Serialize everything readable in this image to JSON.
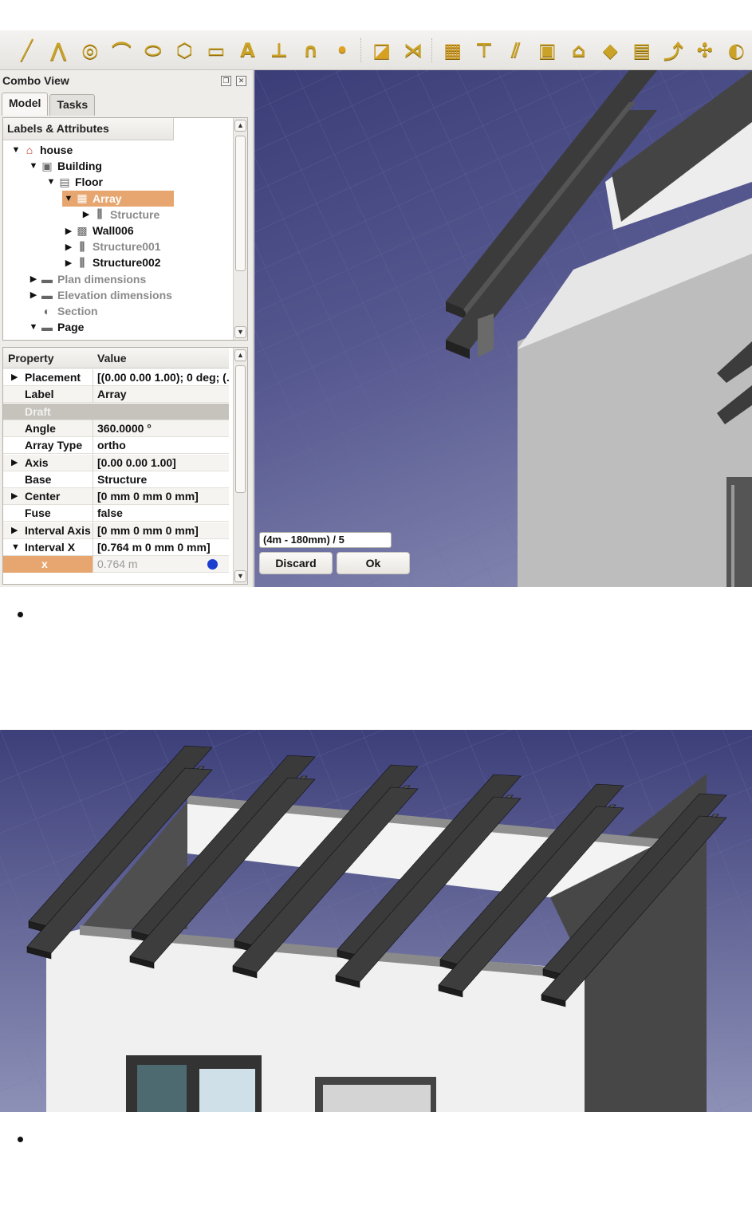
{
  "toolbar": {
    "icons": [
      "line-icon",
      "wire-icon",
      "circle-icon",
      "arc-icon",
      "ellipse-icon",
      "polygon-icon",
      "rectangle-icon",
      "text-icon",
      "dimension-icon",
      "bspline-icon",
      "point-icon",
      "facebinder-icon",
      "bezcurve-icon",
      "wall-icon",
      "structure-icon",
      "rebar-icon",
      "window-icon",
      "building-icon",
      "space-icon",
      "floor-icon",
      "axis-icon",
      "section-plane-icon",
      "site-icon"
    ]
  },
  "combo": {
    "title": "Combo View",
    "tabs": [
      "Model",
      "Tasks"
    ],
    "active_tab": "Model"
  },
  "tree": {
    "header": "Labels & Attributes",
    "rows": [
      {
        "label": "house",
        "arrow": "▼",
        "state": "normal",
        "icon": "site-icon"
      },
      {
        "label": "Building",
        "arrow": "▼",
        "state": "normal",
        "icon": "building-icon"
      },
      {
        "label": "Floor",
        "arrow": "▼",
        "state": "normal",
        "icon": "floor-icon"
      },
      {
        "label": "Array",
        "arrow": "▼",
        "state": "selected",
        "icon": "array-icon"
      },
      {
        "label": "Structure",
        "arrow": "▶",
        "state": "dim",
        "icon": "structure-icon"
      },
      {
        "label": "Wall006",
        "arrow": "▶",
        "state": "normal",
        "icon": "wall-icon"
      },
      {
        "label": "Structure001",
        "arrow": "▶",
        "state": "dim",
        "icon": "structure-icon"
      },
      {
        "label": "Structure002",
        "arrow": "▶",
        "state": "normal",
        "icon": "structure-icon"
      },
      {
        "label": "Plan dimensions",
        "arrow": "▶",
        "state": "dim",
        "icon": "folder-icon"
      },
      {
        "label": "Elevation dimensions",
        "arrow": "▶",
        "state": "dim",
        "icon": "folder-icon"
      },
      {
        "label": "Section",
        "arrow": "",
        "state": "dim",
        "icon": "section-icon"
      },
      {
        "label": "Page",
        "arrow": "▼",
        "state": "normal",
        "icon": "folder-icon"
      }
    ]
  },
  "properties": {
    "col_property": "Property",
    "col_value": "Value",
    "rows": [
      {
        "key": "Placement",
        "value": "[(0.00 0.00 1.00); 0 deg; (...",
        "arrow": "▶",
        "kind": "normal"
      },
      {
        "key": "Label",
        "value": "Array",
        "arrow": "",
        "kind": "normal"
      },
      {
        "key": "Draft",
        "value": "",
        "arrow": "",
        "kind": "group"
      },
      {
        "key": "Angle",
        "value": "360.0000 °",
        "arrow": "",
        "kind": "normal"
      },
      {
        "key": "Array Type",
        "value": "ortho",
        "arrow": "",
        "kind": "normal"
      },
      {
        "key": "Axis",
        "value": "[0.00 0.00 1.00]",
        "arrow": "▶",
        "kind": "normal"
      },
      {
        "key": "Base",
        "value": "Structure",
        "arrow": "",
        "kind": "normal"
      },
      {
        "key": "Center",
        "value": "[0 mm  0 mm  0 mm]",
        "arrow": "▶",
        "kind": "normal"
      },
      {
        "key": "Fuse",
        "value": "false",
        "arrow": "",
        "kind": "normal"
      },
      {
        "key": "Interval Axis",
        "value": "[0 mm  0 mm  0 mm]",
        "arrow": "▶",
        "kind": "normal"
      },
      {
        "key": "Interval X",
        "value": "[0.764 m  0 mm  0 mm]",
        "arrow": "▼",
        "kind": "normal"
      },
      {
        "key": "x",
        "value": "0.764 m",
        "arrow": "",
        "kind": "edit"
      }
    ]
  },
  "task": {
    "expression": "(4m - 180mm) / 5",
    "discard_label": "Discard",
    "ok_label": "Ok"
  },
  "colors": {
    "selection": "#e7a670",
    "viewport_top": "#3b3d78",
    "viewport_bottom": "#8c8fb6",
    "beam": "#3f3f3f",
    "wall": "#efefef"
  }
}
